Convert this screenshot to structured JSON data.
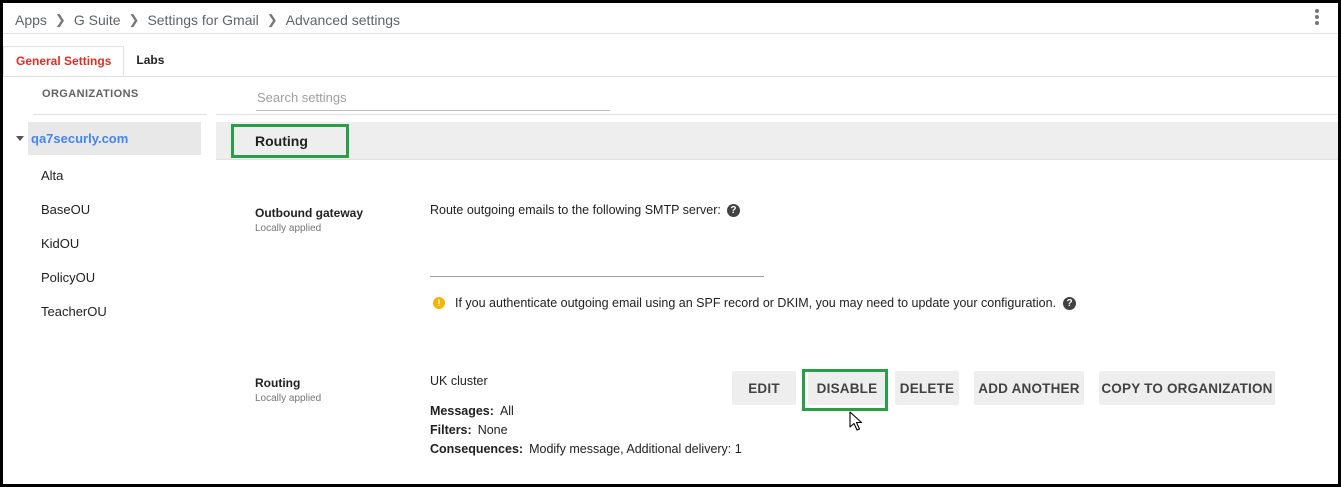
{
  "breadcrumb": {
    "items": [
      "Apps",
      "G Suite",
      "Settings for Gmail",
      "Advanced settings"
    ]
  },
  "tabs": {
    "general": "General Settings",
    "labs": "Labs"
  },
  "sidebar": {
    "heading": "ORGANIZATIONS",
    "root": "qa7securly.com",
    "children": [
      "Alta",
      "BaseOU",
      "KidOU",
      "PolicyOU",
      "TeacherOU"
    ]
  },
  "search": {
    "placeholder": "Search settings"
  },
  "section": {
    "title": "Routing"
  },
  "outbound": {
    "title": "Outbound gateway",
    "subtitle": "Locally applied",
    "description": "Route outgoing emails to the following SMTP server:",
    "server_value": "",
    "warning": "If you authenticate outgoing email using an SPF record or DKIM, you may need to update your configuration."
  },
  "routing": {
    "title": "Routing",
    "subtitle": "Locally applied",
    "rule_name": "UK cluster",
    "messages_label": "Messages:",
    "messages_value": "All",
    "filters_label": "Filters:",
    "filters_value": "None",
    "consequences_label": "Consequences:",
    "consequences_value": "Modify message, Additional delivery: 1",
    "buttons": {
      "edit": "EDIT",
      "disable": "DISABLE",
      "delete": "DELETE",
      "add_another": "ADD ANOTHER",
      "copy": "COPY TO ORGANIZATION"
    }
  },
  "colors": {
    "active_tab": "#d93025",
    "org_link": "#4285f4",
    "highlight_box": "#2a9d48",
    "warning_icon": "#f4b400"
  },
  "icons": [
    "chevron-right-icon",
    "more-vert-icon",
    "caret-down-icon",
    "help-icon",
    "warning-icon",
    "mouse-cursor-icon"
  ]
}
